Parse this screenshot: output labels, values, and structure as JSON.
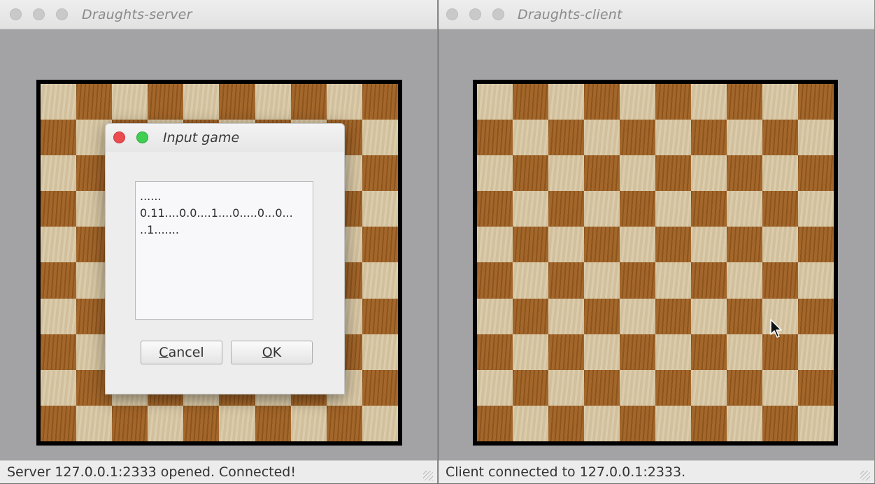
{
  "server_window": {
    "title": "Draughts-server",
    "status": "Server 127.0.0.1:2333 opened. Connected!"
  },
  "client_window": {
    "title": "Draughts-client",
    "status": "Client connected to 127.0.0.1:2333."
  },
  "board": {
    "size": 10,
    "light_color": "#d8c6a2",
    "dark_color": "#9d5d1f",
    "frame_color": "#000000"
  },
  "dialog": {
    "title": "Input game",
    "text_value": "......\n0.11....0.0....1....0.....0...0...\n..1.......",
    "cancel_label": "Cancel",
    "ok_label": "OK",
    "close_color": "#ec4b50",
    "maximize_color": "#3fcf51"
  }
}
